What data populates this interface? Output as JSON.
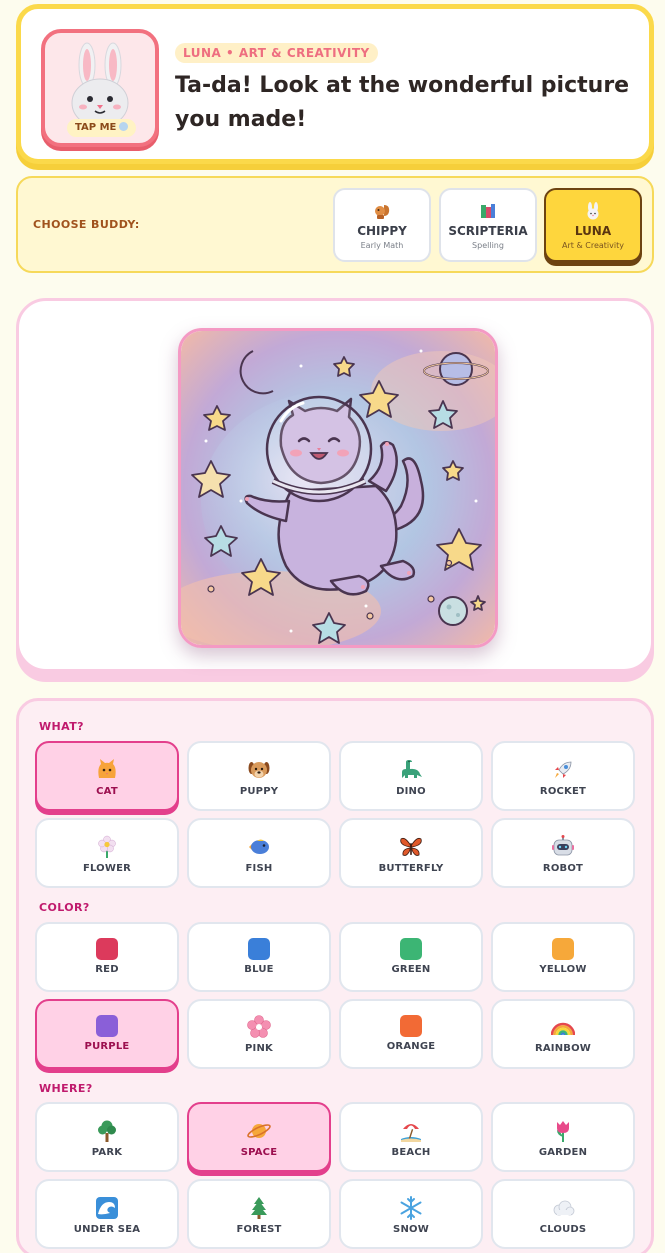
{
  "header": {
    "avatar_label": "TAP ME",
    "buddy_tag": "LUNA • ART & CREATIVITY",
    "headline": "Ta-da! Look at the wonderful picture you made!"
  },
  "buddies": {
    "label": "CHOOSE BUDDY:",
    "items": [
      {
        "name": "CHIPPY",
        "sub": "Early Math",
        "icon": "squirrel-icon"
      },
      {
        "name": "SCRIPTERIA",
        "sub": "Spelling",
        "icon": "books-icon"
      },
      {
        "name": "LUNA",
        "sub": "Art & Creativity",
        "icon": "bunny-icon",
        "selected": true
      }
    ]
  },
  "picture": {
    "description_icon": "space-cat-picture"
  },
  "options": {
    "what": {
      "label": "WHAT?",
      "items": [
        {
          "label": "CAT",
          "icon": "cat-icon",
          "selected": true
        },
        {
          "label": "PUPPY",
          "icon": "puppy-icon"
        },
        {
          "label": "DINO",
          "icon": "dino-icon"
        },
        {
          "label": "ROCKET",
          "icon": "rocket-icon"
        },
        {
          "label": "FLOWER",
          "icon": "flower-icon"
        },
        {
          "label": "FISH",
          "icon": "fish-icon"
        },
        {
          "label": "BUTTERFLY",
          "icon": "butterfly-icon"
        },
        {
          "label": "ROBOT",
          "icon": "robot-icon"
        }
      ]
    },
    "color": {
      "label": "COLOR?",
      "items": [
        {
          "label": "RED",
          "swatch": "#dc3a5c"
        },
        {
          "label": "BLUE",
          "swatch": "#3a7fd9"
        },
        {
          "label": "GREEN",
          "swatch": "#3cb574"
        },
        {
          "label": "YELLOW",
          "swatch": "#f6a83a"
        },
        {
          "label": "PURPLE",
          "swatch": "#8a5fd8",
          "selected": true
        },
        {
          "label": "PINK",
          "swatch": "#f06a9a"
        },
        {
          "label": "ORANGE",
          "swatch": "#f26a35"
        },
        {
          "label": "RAINBOW",
          "swatch": "rainbow"
        }
      ]
    },
    "where": {
      "label": "WHERE?",
      "items": [
        {
          "label": "PARK",
          "icon": "tree-icon"
        },
        {
          "label": "SPACE",
          "icon": "planet-icon",
          "selected": true
        },
        {
          "label": "BEACH",
          "icon": "beach-icon"
        },
        {
          "label": "GARDEN",
          "icon": "tulip-icon"
        },
        {
          "label": "UNDER SEA",
          "icon": "wave-icon"
        },
        {
          "label": "FOREST",
          "icon": "pine-icon"
        },
        {
          "label": "SNOW",
          "icon": "snowflake-icon"
        },
        {
          "label": "CLOUDS",
          "icon": "cloud-icon"
        }
      ]
    }
  },
  "colors": {
    "yellow_accent": "#fbd94a",
    "pink_accent": "#e33f8c",
    "selected_buddy": "#fed63d"
  }
}
